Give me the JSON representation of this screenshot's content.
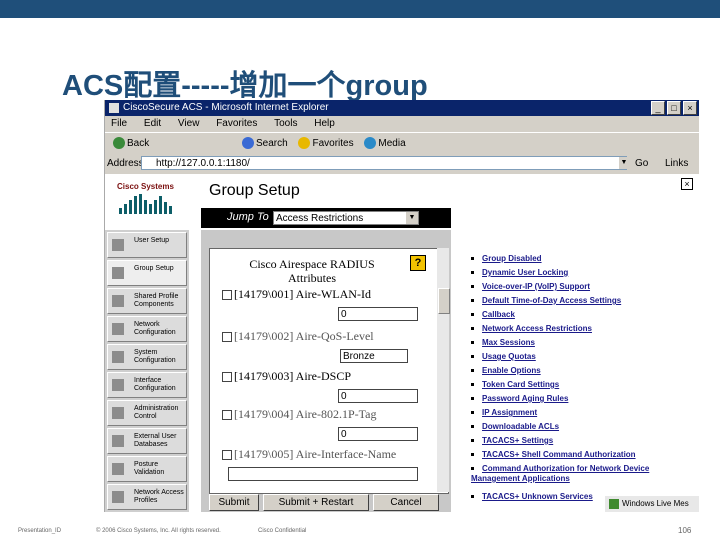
{
  "slide": {
    "title": "ACS配置-----增加一个group",
    "footer_left": "Presentation_ID",
    "footer_copyright": "© 2006 Cisco Systems, Inc. All rights reserved.",
    "footer_confidential": "Cisco Confidential",
    "page_number": "106"
  },
  "browser": {
    "window_title": "CiscoSecure ACS - Microsoft Internet Explorer",
    "menu": [
      "File",
      "Edit",
      "View",
      "Favorites",
      "Tools",
      "Help"
    ],
    "toolbar": [
      {
        "label": "Back",
        "icon": "back-arrow-icon",
        "color": "#3a8a3a"
      },
      {
        "label": "Search",
        "icon": "search-icon",
        "color": "#3a6ad4"
      },
      {
        "label": "Favorites",
        "icon": "favorites-star-icon",
        "color": "#e8b800"
      },
      {
        "label": "Media",
        "icon": "media-icon",
        "color": "#2a8ac8"
      }
    ],
    "address_label": "Address",
    "address_value": "http://127.0.0.1:1180/",
    "go_label": "Go",
    "links_label": "Links"
  },
  "acs": {
    "logo_text": "Cisco Systems",
    "page_heading": "Group Setup",
    "nav": [
      {
        "label": "User Setup",
        "icon": "user-setup-icon"
      },
      {
        "label": "Group Setup",
        "icon": "group-setup-icon"
      },
      {
        "label": "Shared Profile Components",
        "icon": "shared-profile-icon"
      },
      {
        "label": "Network Configuration",
        "icon": "network-config-icon"
      },
      {
        "label": "System Configuration",
        "icon": "system-config-icon"
      },
      {
        "label": "Interface Configuration",
        "icon": "interface-config-icon"
      },
      {
        "label": "Administration Control",
        "icon": "admin-control-icon"
      },
      {
        "label": "External User Databases",
        "icon": "external-db-icon"
      },
      {
        "label": "Posture Validation",
        "icon": "posture-icon"
      },
      {
        "label": "Network Access Profiles",
        "icon": "access-profiles-icon"
      }
    ],
    "jump_label": "Jump To",
    "jump_value": "Access Restrictions",
    "section_title": "Cisco Airespace RADIUS Attributes",
    "attributes": [
      {
        "label": "[14179\\001] Aire-WLAN-Id",
        "value": "0",
        "control": "input"
      },
      {
        "label": "[14179\\002] Aire-QoS-Level",
        "value": "Bronze",
        "control": "select"
      },
      {
        "label": "[14179\\003] Aire-DSCP",
        "value": "0",
        "control": "input"
      },
      {
        "label": "[14179\\004] Aire-802.1P-Tag",
        "value": "0",
        "control": "input"
      },
      {
        "label": "[14179\\005] Aire-Interface-Name",
        "value": "",
        "control": "input"
      }
    ],
    "buttons": {
      "submit": "Submit",
      "submit_restart": "Submit + Restart",
      "cancel": "Cancel"
    },
    "links": [
      "Group Disabled",
      "Dynamic User Locking",
      "Voice-over-IP (VoIP) Support",
      "Default Time-of-Day Access Settings",
      "Callback",
      "Network Access Restrictions",
      "Max Sessions",
      "Usage Quotas",
      "Enable Options",
      "Token Card Settings",
      "Password Aging Rules",
      "IP Assignment",
      "Downloadable ACLs",
      "TACACS+ Settings",
      "TACACS+ Shell Command Authorization",
      "Command Authorization for Network Device Management Applications",
      "TACACS+ Unknown Services"
    ],
    "live_bar": "Windows Live Mes"
  },
  "colors": {
    "slide_title": "#1f4e79",
    "titlebar": "#0a246a",
    "jump_bar": "#000000",
    "help_icon": "#f2c200"
  }
}
